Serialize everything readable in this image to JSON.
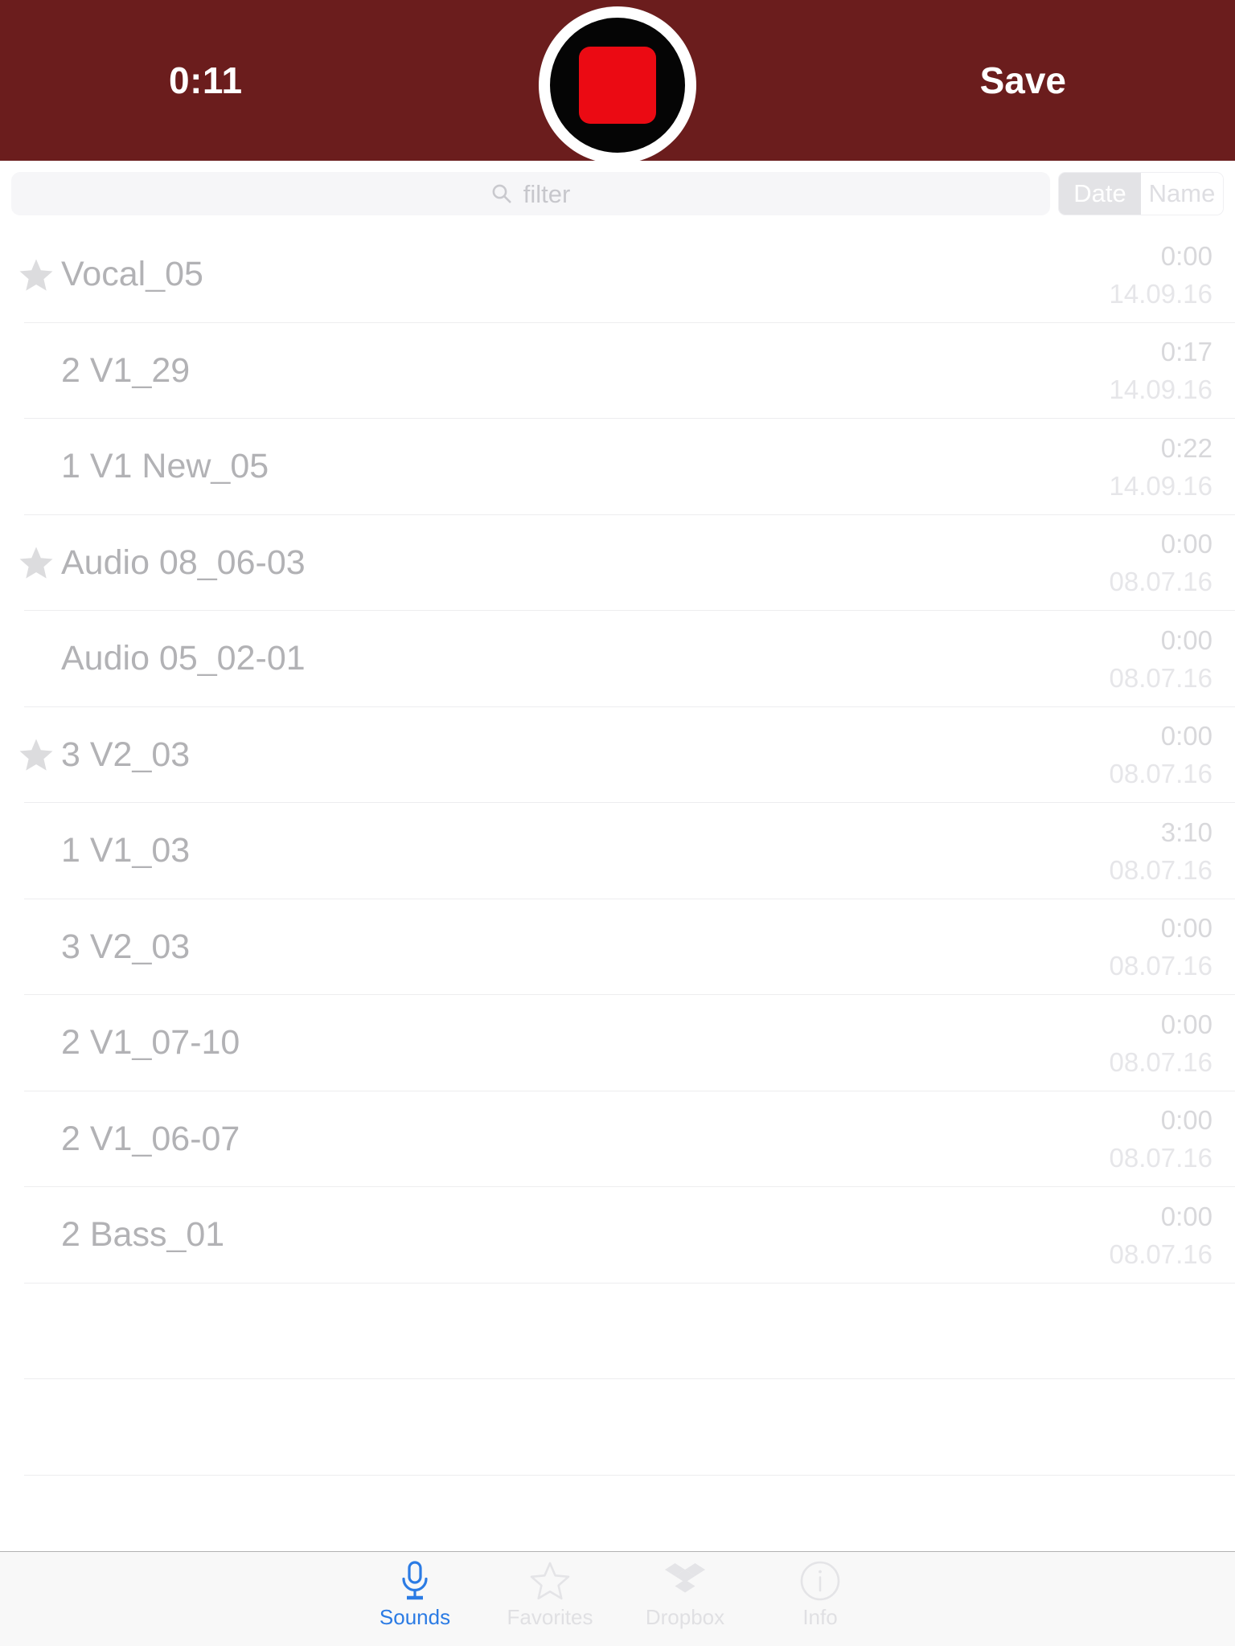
{
  "header": {
    "timer": "0:11",
    "save_label": "Save",
    "record_button_icon": "stop-square-icon",
    "bar_color": "#6B1D1D",
    "stop_color": "#EB0A13"
  },
  "filter": {
    "search_icon": "search-icon",
    "placeholder": "filter",
    "value": "",
    "sort_options": [
      {
        "label": "Date",
        "selected": true
      },
      {
        "label": "Name",
        "selected": false
      }
    ]
  },
  "list": {
    "columns": [
      "name",
      "duration",
      "date"
    ],
    "rows": [
      {
        "starred": true,
        "name": "Vocal_05",
        "duration": "0:00",
        "date": "14.09.16"
      },
      {
        "starred": false,
        "name": "2 V1_29",
        "duration": "0:17",
        "date": "14.09.16"
      },
      {
        "starred": false,
        "name": "1 V1 New_05",
        "duration": "0:22",
        "date": "14.09.16"
      },
      {
        "starred": true,
        "name": "Audio 08_06-03",
        "duration": "0:00",
        "date": "08.07.16"
      },
      {
        "starred": false,
        "name": "Audio 05_02-01",
        "duration": "0:00",
        "date": "08.07.16"
      },
      {
        "starred": true,
        "name": "3 V2_03",
        "duration": "0:00",
        "date": "08.07.16"
      },
      {
        "starred": false,
        "name": "1 V1_03",
        "duration": "3:10",
        "date": "08.07.16"
      },
      {
        "starred": false,
        "name": "3 V2_03",
        "duration": "0:00",
        "date": "08.07.16"
      },
      {
        "starred": false,
        "name": "2 V1_07-10",
        "duration": "0:00",
        "date": "08.07.16"
      },
      {
        "starred": false,
        "name": "2 V1_06-07",
        "duration": "0:00",
        "date": "08.07.16"
      },
      {
        "starred": false,
        "name": "2 Bass_01",
        "duration": "0:00",
        "date": "08.07.16"
      }
    ],
    "empty_row_count": 3
  },
  "tabs": [
    {
      "label": "Sounds",
      "icon": "microphone-icon",
      "active": true
    },
    {
      "label": "Favorites",
      "icon": "star-outline-icon",
      "active": false
    },
    {
      "label": "Dropbox",
      "icon": "dropbox-icon",
      "active": false
    },
    {
      "label": "Info",
      "icon": "info-circle-icon",
      "active": false
    }
  ],
  "colors": {
    "header": "#6B1D1D",
    "record_red": "#EB0A13",
    "accent_blue": "#2B7BE4",
    "row_text": "#B2B2B5",
    "separator": "#EDEDEF"
  }
}
